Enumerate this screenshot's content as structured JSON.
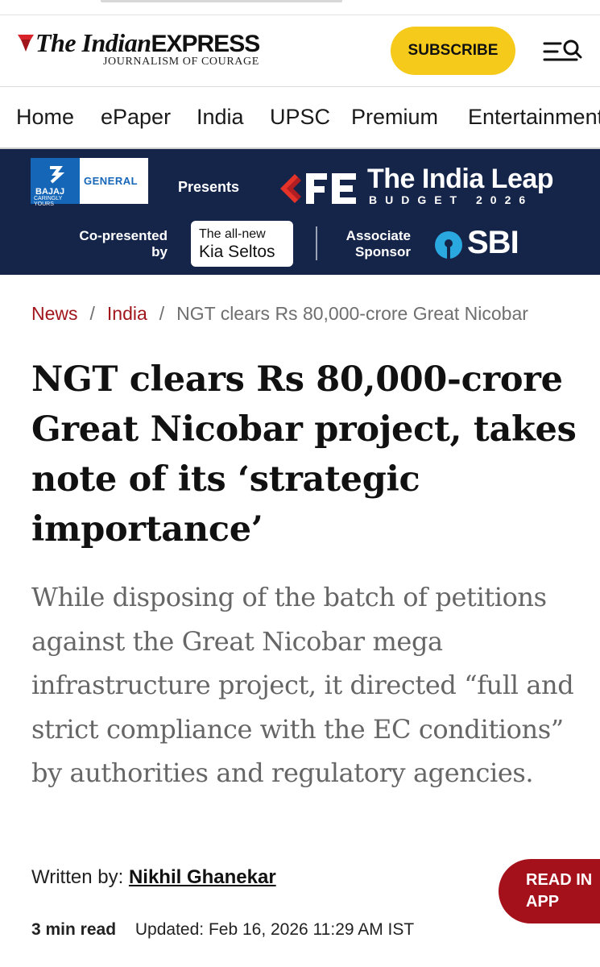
{
  "colors": {
    "accent_red": "#a1161c",
    "subscribe_yellow": "#f5ca1b",
    "banner_navy": "#15254a",
    "read_in_app_red": "#a5111b"
  },
  "header": {
    "logo_part1": "The Indian",
    "logo_part2": "EXPRESS",
    "tagline": "JOURNALISM OF COURAGE",
    "subscribe_label": "SUBSCRIBE",
    "menu_icon": "menu-search-icon"
  },
  "nav": {
    "items": [
      "Home",
      "ePaper",
      "India",
      "UPSC",
      "Premium",
      "Entertainment"
    ]
  },
  "banner": {
    "sponsor_name": "BAJAJ",
    "sponsor_brand": "GENERAL",
    "sponsor_tagline": "CARINGLY YOURS",
    "presents": "Presents",
    "fe_title": "The India Leap",
    "fe_subtitle": "BUDGET 2026",
    "copresented_line1": "Co-presented",
    "copresented_line2": "by",
    "kia_line1": "The all-new",
    "kia_line2": "Kia Seltos",
    "associate_line1": "Associate",
    "associate_line2": "Sponsor",
    "sbi": "SBI"
  },
  "breadcrumb": {
    "items": [
      "News",
      "India"
    ],
    "current": "NGT clears Rs 80,000-crore Great Nicobar"
  },
  "article": {
    "headline": "NGT clears Rs 80,000-crore Great Nicobar project, takes note of its ‘strategic importance’",
    "dek": "While disposing of the batch of petitions against the Great Nicobar mega infrastructure project, it directed “full and strict compliance with the EC conditions” by authorities and regulatory agencies.",
    "byline_label": "Written by:",
    "author": "Nikhil Ghanekar",
    "read_time": "3 min read",
    "updated": "Updated: Feb 16, 2026 11:29 AM IST"
  },
  "read_in_app": {
    "line1": "READ IN",
    "line2": "APP"
  }
}
